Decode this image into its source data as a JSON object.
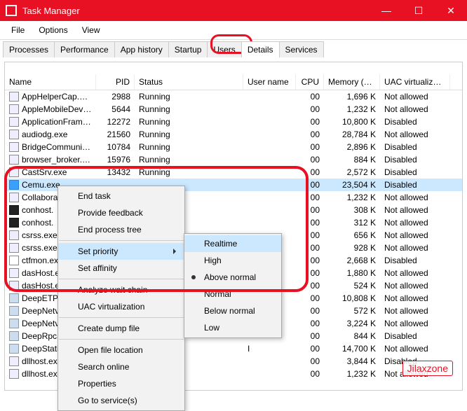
{
  "window": {
    "title": "Task Manager"
  },
  "menu": {
    "file": "File",
    "options": "Options",
    "view": "View"
  },
  "tabs": {
    "processes": "Processes",
    "performance": "Performance",
    "apphistory": "App history",
    "startup": "Startup",
    "users": "Users",
    "details": "Details",
    "services": "Services"
  },
  "columns": {
    "name": "Name",
    "pid": "PID",
    "status": "Status",
    "user": "User name",
    "cpu": "CPU",
    "mem": "Memory (a...",
    "uac": "UAC virtualizat..."
  },
  "rows": [
    {
      "name": "AppHelperCap.exe",
      "pid": "2988",
      "status": "Running",
      "user": "",
      "cpu": "00",
      "mem": "1,696 K",
      "uac": "Not allowed",
      "icon": ""
    },
    {
      "name": "AppleMobileDeviceS...",
      "pid": "5644",
      "status": "Running",
      "user": "",
      "cpu": "00",
      "mem": "1,232 K",
      "uac": "Not allowed",
      "icon": ""
    },
    {
      "name": "ApplicationFrameHo...",
      "pid": "12272",
      "status": "Running",
      "user": "",
      "cpu": "00",
      "mem": "10,800 K",
      "uac": "Disabled",
      "icon": ""
    },
    {
      "name": "audiodg.exe",
      "pid": "21560",
      "status": "Running",
      "user": "",
      "cpu": "00",
      "mem": "28,784 K",
      "uac": "Not allowed",
      "icon": ""
    },
    {
      "name": "BridgeCommunicati...",
      "pid": "10784",
      "status": "Running",
      "user": "",
      "cpu": "00",
      "mem": "2,896 K",
      "uac": "Disabled",
      "icon": ""
    },
    {
      "name": "browser_broker.exe",
      "pid": "15976",
      "status": "Running",
      "user": "",
      "cpu": "00",
      "mem": "884 K",
      "uac": "Disabled",
      "icon": ""
    },
    {
      "name": "CastSrv.exe",
      "pid": "13432",
      "status": "Running",
      "user": "",
      "cpu": "00",
      "mem": "2,572 K",
      "uac": "Disabled",
      "icon": ""
    },
    {
      "name": "Cemu.exe",
      "pid": "",
      "status": "",
      "user": "",
      "cpu": "00",
      "mem": "23,504 K",
      "uac": "Disabled",
      "icon": "blue",
      "selected": true
    },
    {
      "name": "Collabora",
      "pid": "",
      "status": "",
      "user": "",
      "cpu": "00",
      "mem": "1,232 K",
      "uac": "Not allowed",
      "icon": ""
    },
    {
      "name": "conhost.",
      "pid": "",
      "status": "",
      "user": "",
      "cpu": "00",
      "mem": "308 K",
      "uac": "Not allowed",
      "icon": "dark"
    },
    {
      "name": "conhost.",
      "pid": "",
      "status": "",
      "user": "",
      "cpu": "00",
      "mem": "312 K",
      "uac": "Not allowed",
      "icon": "dark"
    },
    {
      "name": "csrss.exe",
      "pid": "",
      "status": "",
      "user": "",
      "cpu": "00",
      "mem": "656 K",
      "uac": "Not allowed",
      "icon": ""
    },
    {
      "name": "csrss.exe",
      "pid": "",
      "status": "",
      "user": "",
      "cpu": "00",
      "mem": "928 K",
      "uac": "Not allowed",
      "icon": ""
    },
    {
      "name": "ctfmon.ex",
      "pid": "",
      "status": "",
      "user": "",
      "cpu": "00",
      "mem": "2,668 K",
      "uac": "Disabled",
      "icon": "pen"
    },
    {
      "name": "dasHost.e",
      "pid": "",
      "status": "",
      "user": "",
      "cpu": "00",
      "mem": "1,880 K",
      "uac": "Not allowed",
      "icon": ""
    },
    {
      "name": "dasHost.e",
      "pid": "",
      "status": "",
      "user": "",
      "cpu": "00",
      "mem": "524 K",
      "uac": "Not allowed",
      "icon": ""
    },
    {
      "name": "DeepETPS",
      "pid": "",
      "status": "",
      "user": "",
      "cpu": "00",
      "mem": "10,808 K",
      "uac": "Not allowed",
      "icon": "shield"
    },
    {
      "name": "DeepNetv",
      "pid": "",
      "status": "",
      "user": "",
      "cpu": "00",
      "mem": "572 K",
      "uac": "Not allowed",
      "icon": "shield"
    },
    {
      "name": "DeepNetv",
      "pid": "",
      "status": "",
      "user": "",
      "cpu": "00",
      "mem": "3,224 K",
      "uac": "Not allowed",
      "icon": "shield"
    },
    {
      "name": "DeepRpcS",
      "pid": "",
      "status": "",
      "user": "",
      "cpu": "00",
      "mem": "844 K",
      "uac": "Disabled",
      "icon": "shield"
    },
    {
      "name": "DeepStatic",
      "pid": "",
      "status": "",
      "user": "I",
      "cpu": "00",
      "mem": "14,700 K",
      "uac": "Not allowed",
      "icon": "shield"
    },
    {
      "name": "dllhost.ex",
      "pid": "",
      "status": "",
      "user": "",
      "cpu": "00",
      "mem": "3,844 K",
      "uac": "Disabled",
      "icon": ""
    },
    {
      "name": "dllhost.ex",
      "pid": "",
      "status": "",
      "user": "",
      "cpu": "00",
      "mem": "1,232 K",
      "uac": "Not allowed",
      "icon": ""
    }
  ],
  "context_menu": {
    "end_task": "End task",
    "provide_feedback": "Provide feedback",
    "end_tree": "End process tree",
    "set_priority": "Set priority",
    "set_affinity": "Set affinity",
    "analyze": "Analyze wait chain",
    "uac": "UAC virtualization",
    "dump": "Create dump file",
    "open_loc": "Open file location",
    "search": "Search online",
    "properties": "Properties",
    "goto_svc": "Go to service(s)"
  },
  "priority_menu": {
    "realtime": "Realtime",
    "high": "High",
    "above_normal": "Above normal",
    "normal": "Normal",
    "below_normal": "Below normal",
    "low": "Low"
  },
  "watermark": "Jilaxzone"
}
